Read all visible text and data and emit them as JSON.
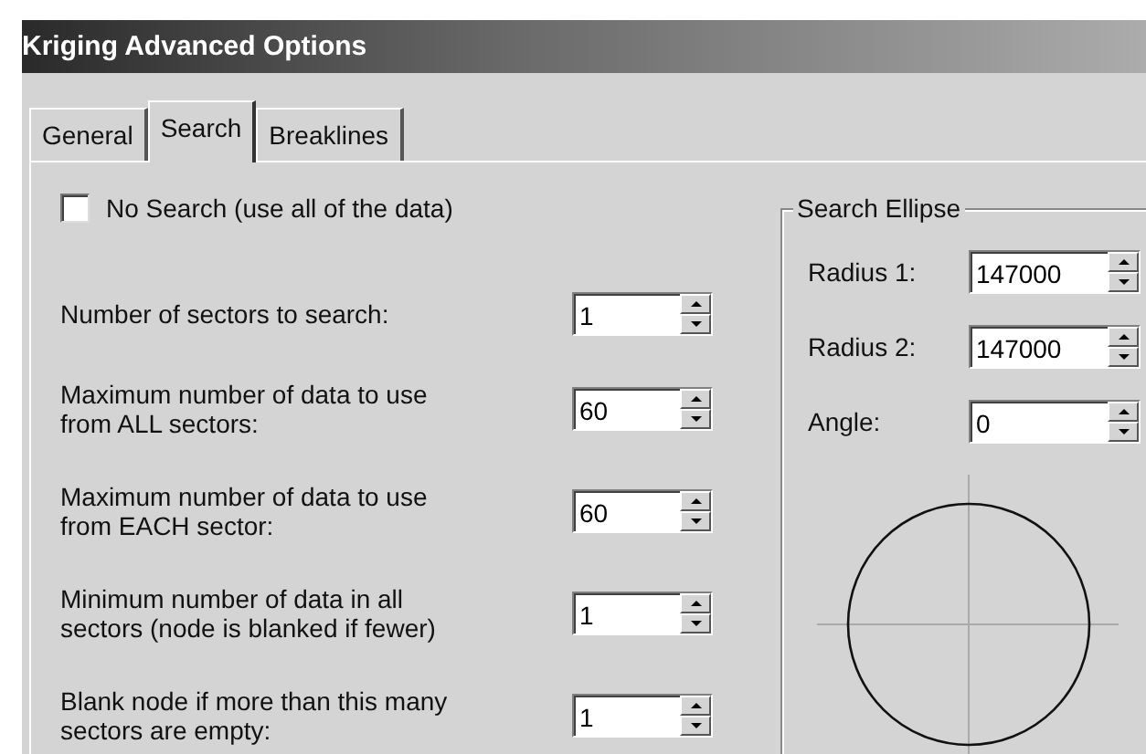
{
  "window": {
    "title": "Kriging Advanced Options"
  },
  "tabs": [
    {
      "label": "General",
      "selected": false
    },
    {
      "label": "Search",
      "selected": true
    },
    {
      "label": "Breaklines",
      "selected": false
    }
  ],
  "no_search": {
    "label": "No Search (use all of the data)",
    "checked": false
  },
  "fields": [
    {
      "label": "Number of sectors to search:",
      "value": "1"
    },
    {
      "label": "Maximum number of data to use\nfrom ALL sectors:",
      "value": "60"
    },
    {
      "label": "Maximum number of data to use\nfrom EACH sector:",
      "value": "60"
    },
    {
      "label": "Minimum number of data in all\nsectors (node is blanked if fewer)",
      "value": "1"
    },
    {
      "label": "Blank node if more than this many\nsectors are empty:",
      "value": "1"
    }
  ],
  "search_ellipse": {
    "title": "Search Ellipse",
    "fields": [
      {
        "label": "Radius 1:",
        "value": "147000"
      },
      {
        "label": "Radius 2:",
        "value": "147000"
      },
      {
        "label": "Angle:",
        "value": "0"
      }
    ]
  }
}
